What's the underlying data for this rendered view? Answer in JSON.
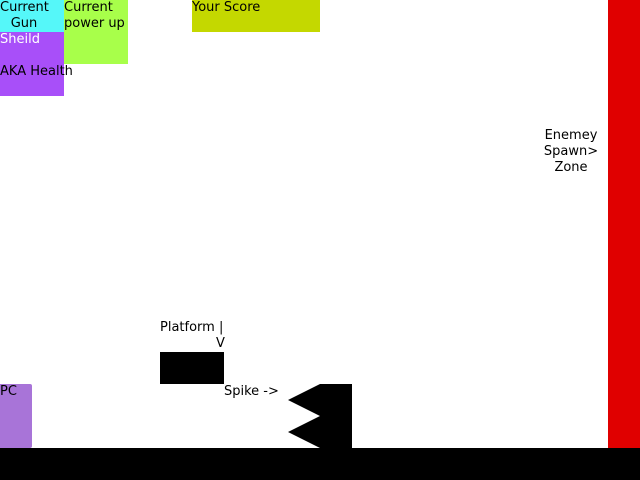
{
  "colors": {
    "gun": "#55f7f9",
    "powerup": "#a8ff4a",
    "score": "#c4d800",
    "shield": "#a84ff9",
    "spawn_zone": "#e00000",
    "player": "#a874d8",
    "ground": "#000000",
    "platform": "#000000",
    "spike": "#000000"
  },
  "hud": {
    "gun_label": "Current\nGun",
    "powerup_label": "Current\npower up",
    "score_label": "Your Score",
    "shield_label": "Sheild",
    "health_label": "AKA Health"
  },
  "world": {
    "spawn_label": "Enemey\nSpawn>\nZone",
    "platform_label": "Platform |",
    "platform_arrow": "V",
    "spike_label": "Spike ->",
    "player_label": "PC"
  }
}
